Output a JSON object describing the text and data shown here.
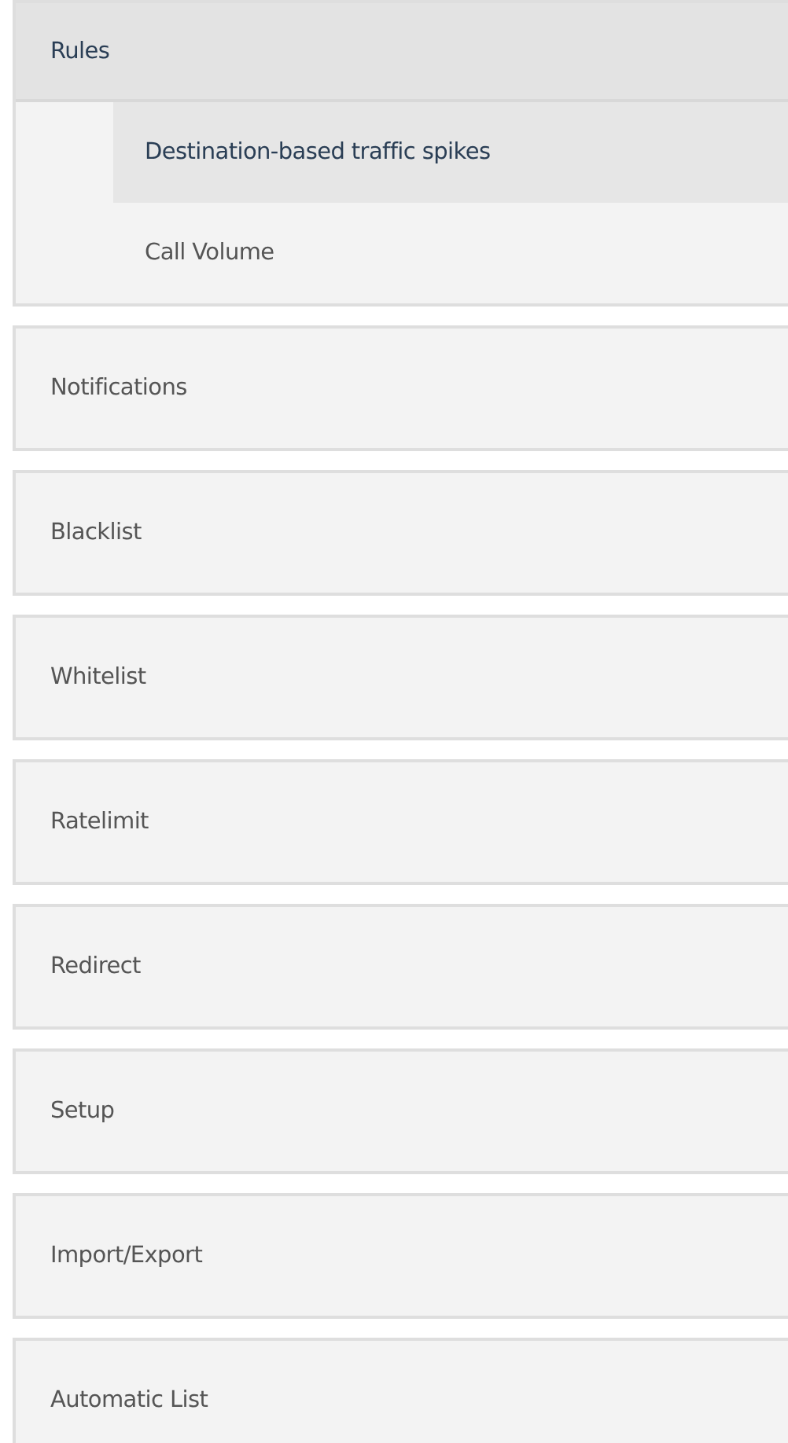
{
  "sections": [
    {
      "label": "Rules",
      "expanded": true,
      "children": [
        {
          "label": "Destination-based traffic spikes",
          "selected": true
        },
        {
          "label": "Call Volume",
          "selected": false
        }
      ]
    },
    {
      "label": "Notifications",
      "expanded": false
    },
    {
      "label": "Blacklist",
      "expanded": false
    },
    {
      "label": "Whitelist",
      "expanded": false
    },
    {
      "label": "Ratelimit",
      "expanded": false
    },
    {
      "label": "Redirect",
      "expanded": false
    },
    {
      "label": "Setup",
      "expanded": false
    },
    {
      "label": "Import/Export",
      "expanded": false
    },
    {
      "label": "Automatic List",
      "expanded": false
    }
  ]
}
